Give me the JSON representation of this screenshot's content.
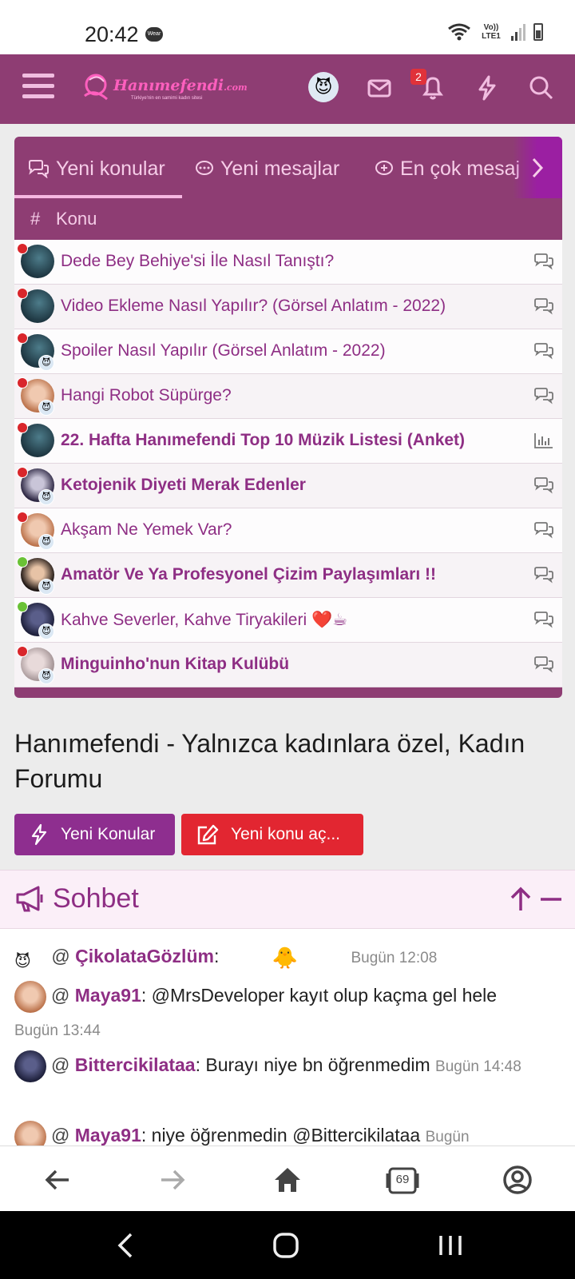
{
  "status": {
    "time": "20:42",
    "wear": "Wear",
    "net": "Vo)) LTE1"
  },
  "header": {
    "logo_text": "Hanımefendi",
    "logo_domain": ".com",
    "logo_tagline": "Türkiye'nin en samimi kadın sitesi",
    "notification_count": "2"
  },
  "tabs": [
    {
      "label": "Yeni konular"
    },
    {
      "label": "Yeni mesajlar"
    },
    {
      "label": "En çok mesaj"
    }
  ],
  "table": {
    "hash": "#",
    "column": "Konu",
    "rows": [
      {
        "title": "Dede Bey Behiye'si İle Nasıl Tanıştı?",
        "bold": false,
        "dot": "red",
        "icon": "chat"
      },
      {
        "title": "Video Ekleme Nasıl Yapılır? (Görsel Anlatım - 2022)",
        "bold": false,
        "dot": "red",
        "icon": "chat"
      },
      {
        "title": "Spoiler Nasıl Yapılır (Görsel Anlatım - 2022)",
        "bold": false,
        "dot": "red",
        "icon": "chat"
      },
      {
        "title": "Hangi Robot Süpürge?",
        "bold": false,
        "dot": "red",
        "icon": "chat"
      },
      {
        "title": "22. Hafta Hanımefendi Top 10 Müzik Listesi (Anket)",
        "bold": true,
        "dot": "red",
        "icon": "poll"
      },
      {
        "title": "Ketojenik Diyeti Merak Edenler",
        "bold": true,
        "dot": "red",
        "icon": "chat"
      },
      {
        "title": "Akşam Ne Yemek Var?",
        "bold": false,
        "dot": "red",
        "icon": "chat"
      },
      {
        "title": "Amatör Ve Ya Profesyonel Çizim Paylaşımları !!",
        "bold": true,
        "dot": "green",
        "icon": "chat"
      },
      {
        "title": "Kahve Severler, Kahve Tiryakileri ❤️☕",
        "bold": false,
        "dot": "green",
        "icon": "chat"
      },
      {
        "title": "Minguinho'nun Kitap Kulübü",
        "bold": true,
        "dot": "red",
        "icon": "chat"
      }
    ]
  },
  "page": {
    "title": "Hanımefendi - Yalnızca kadınlara özel, Kadın Forumu"
  },
  "buttons": {
    "new_topics": "Yeni Konular",
    "new_thread": "Yeni konu aç..."
  },
  "chat": {
    "title": "Sohbet",
    "messages": [
      {
        "user": "ÇikolataGözlüm",
        "text": ":",
        "time": "Bugün 12:08"
      },
      {
        "user": "Maya91",
        "text": ": @MrsDeveloper kayıt olup kaçma gel hele",
        "time": "Bugün 13:44"
      },
      {
        "user": "Bittercikilataa",
        "text": ": Burayı niye bn öğrenmedim",
        "time": "Bugün 14:48"
      },
      {
        "user": "Maya91",
        "text": ": niye öğrenmedin @Bittercikilataa",
        "time": "Bugün"
      }
    ]
  },
  "browser": {
    "tab_count": "69"
  },
  "colors": {
    "primary": "#8e3d73",
    "accent": "#8e2e84",
    "danger": "#e22631",
    "online": "#6ac236",
    "unread": "#d9262b"
  }
}
